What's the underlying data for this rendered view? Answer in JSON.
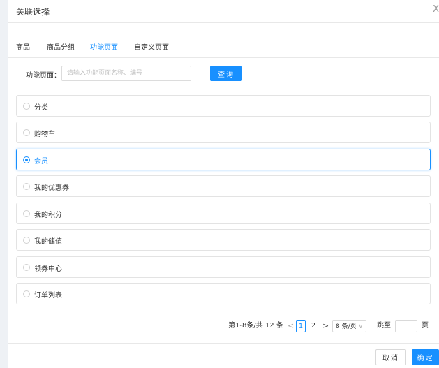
{
  "dialog": {
    "title": "关联选择",
    "close_glyph": "X"
  },
  "tabs": [
    {
      "label": "商品",
      "active": false
    },
    {
      "label": "商品分组",
      "active": false
    },
    {
      "label": "功能页面",
      "active": true
    },
    {
      "label": "自定义页面",
      "active": false
    }
  ],
  "search": {
    "label": "功能页面：",
    "placeholder": "请输入功能页面名称、编号",
    "value": "",
    "button_label": "查询"
  },
  "items": [
    {
      "label": "分类",
      "selected": false
    },
    {
      "label": "购物车",
      "selected": false
    },
    {
      "label": "会员",
      "selected": true
    },
    {
      "label": "我的优惠券",
      "selected": false
    },
    {
      "label": "我的积分",
      "selected": false
    },
    {
      "label": "我的储值",
      "selected": false
    },
    {
      "label": "领券中心",
      "selected": false
    },
    {
      "label": "订单列表",
      "selected": false
    }
  ],
  "pagination": {
    "summary": "第1-8条/共 12 条",
    "prev_glyph": "<",
    "next_glyph": ">",
    "pages": [
      "1",
      "2"
    ],
    "current_page": "1",
    "page_size": "8 条/页",
    "page_size_arrow": "∨",
    "jump_label": "跳至",
    "jump_value": "",
    "jump_suffix": "页"
  },
  "footer": {
    "cancel_label": "取消",
    "confirm_label": "确定"
  },
  "colors": {
    "accent": "#1890ff",
    "border": "#e3e3e3",
    "background": "#eef1f5"
  }
}
